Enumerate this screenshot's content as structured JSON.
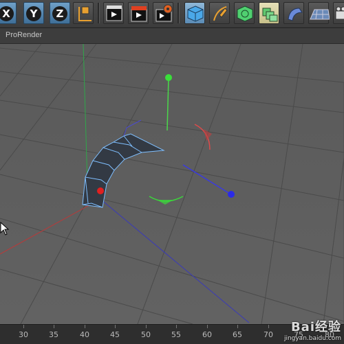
{
  "toolbar": {
    "axis_buttons": [
      {
        "label": "X"
      },
      {
        "label": "Y"
      },
      {
        "label": "Z"
      }
    ],
    "icons": [
      "world-coordinates-icon",
      "render-view-icon",
      "render-to-picture-viewer-icon",
      "render-settings-icon",
      "cube-object-icon",
      "pen-spline-icon",
      "subdivision-surface-icon",
      "array-icon",
      "deformer-icon",
      "floor-icon",
      "camera-icon"
    ]
  },
  "viewport": {
    "title": "ProRender"
  },
  "ruler": {
    "labels": [
      "30",
      "35",
      "40",
      "45",
      "50",
      "55",
      "60",
      "65",
      "70",
      "75",
      "80"
    ]
  },
  "watermark": {
    "main": "Bai经验",
    "sub": "jingyan.baidu.com"
  }
}
